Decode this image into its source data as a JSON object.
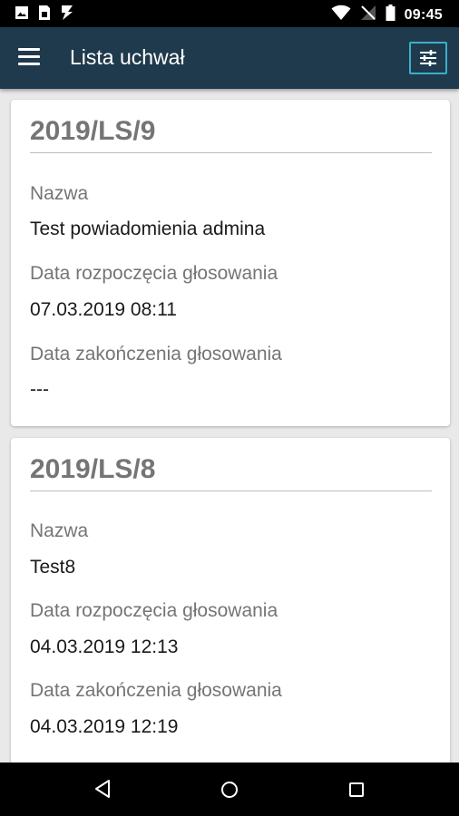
{
  "status_bar": {
    "time": "09:45",
    "left_icons": [
      "image-icon",
      "sim-card-icon",
      "flash-icon"
    ],
    "right_icons": [
      "wifi-icon",
      "no-signal-icon",
      "battery-icon"
    ]
  },
  "app_bar": {
    "title": "Lista uchwał",
    "menu_icon": "menu-icon",
    "filter_icon": "tune-icon",
    "accent_color": "#39b0c8",
    "background_color": "#1f3a4d"
  },
  "cards": [
    {
      "title": "2019/LS/9",
      "fields": [
        {
          "label": "Nazwa",
          "value": "Test powiadomienia admina"
        },
        {
          "label": "Data rozpoczęcia głosowania",
          "value": "07.03.2019 08:11"
        },
        {
          "label": "Data zakończenia głosowania",
          "value": "---"
        }
      ]
    },
    {
      "title": "2019/LS/8",
      "fields": [
        {
          "label": "Nazwa",
          "value": "Test8"
        },
        {
          "label": "Data rozpoczęcia głosowania",
          "value": "04.03.2019 12:13"
        },
        {
          "label": "Data zakończenia głosowania",
          "value": "04.03.2019 12:19"
        }
      ]
    }
  ],
  "nav_bar": {
    "icons": [
      "back-icon",
      "home-icon",
      "recents-icon"
    ]
  }
}
